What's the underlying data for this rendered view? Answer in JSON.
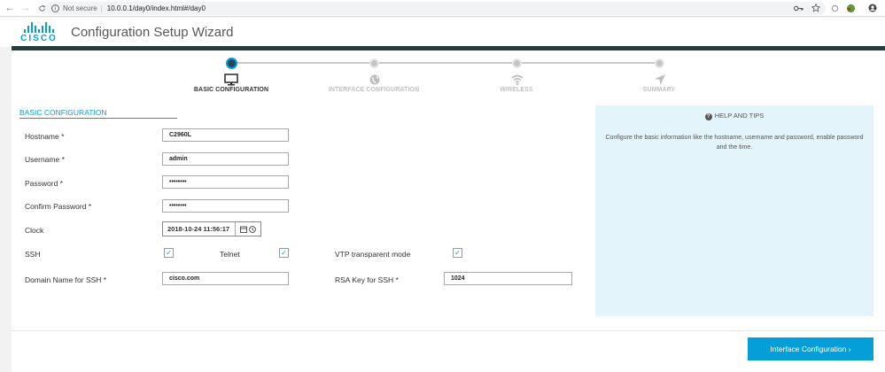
{
  "browser": {
    "back_icon": "←",
    "forward_icon": "→",
    "reload_icon": "C",
    "security_label": "Not secure",
    "separator": "|",
    "url": "10.0.0.1/day0/index.html#/day0"
  },
  "app": {
    "logo_text": "CISCO",
    "title": "Configuration Setup Wizard"
  },
  "steps": [
    {
      "label": "BASIC CONFIGURATION",
      "active": true,
      "icon": "monitor-icon"
    },
    {
      "label": "INTERFACE CONFIGURATION",
      "active": false,
      "icon": "globe-icon"
    },
    {
      "label": "WIRELESS",
      "active": false,
      "icon": "wifi-icon"
    },
    {
      "label": "SUMMARY",
      "active": false,
      "icon": "navigation-arrow-icon"
    }
  ],
  "form": {
    "section_title": "BASIC CONFIGURATION",
    "hostname_label": "Hostname *",
    "hostname_value": "C2960L",
    "username_label": "Username *",
    "username_value": "admin",
    "password_label": "Password *",
    "password_value": "••••••••",
    "confirm_password_label": "Confirm Password *",
    "confirm_password_value": "••••••••",
    "clock_label": "Clock",
    "clock_value": "2018-10-24 11:56:17",
    "ssh_label": "SSH",
    "ssh_checked": true,
    "telnet_label": "Telnet",
    "telnet_checked": true,
    "vtp_label": "VTP transparent mode",
    "vtp_checked": true,
    "domain_label": "Domain Name for SSH *",
    "domain_value": "cisco.com",
    "rsa_label": "RSA Key for SSH *",
    "rsa_value": "1024",
    "check_mark": "✓"
  },
  "help": {
    "title": "HELP AND TIPS",
    "text": "Configure the basic information like the hostname, username and password, enable password and the time."
  },
  "footer": {
    "next_label": "Interface Configuration ›"
  },
  "colors": {
    "accent": "#049fd9",
    "header_rule": "#2b3a41",
    "help_bg": "#e3f4fb"
  }
}
